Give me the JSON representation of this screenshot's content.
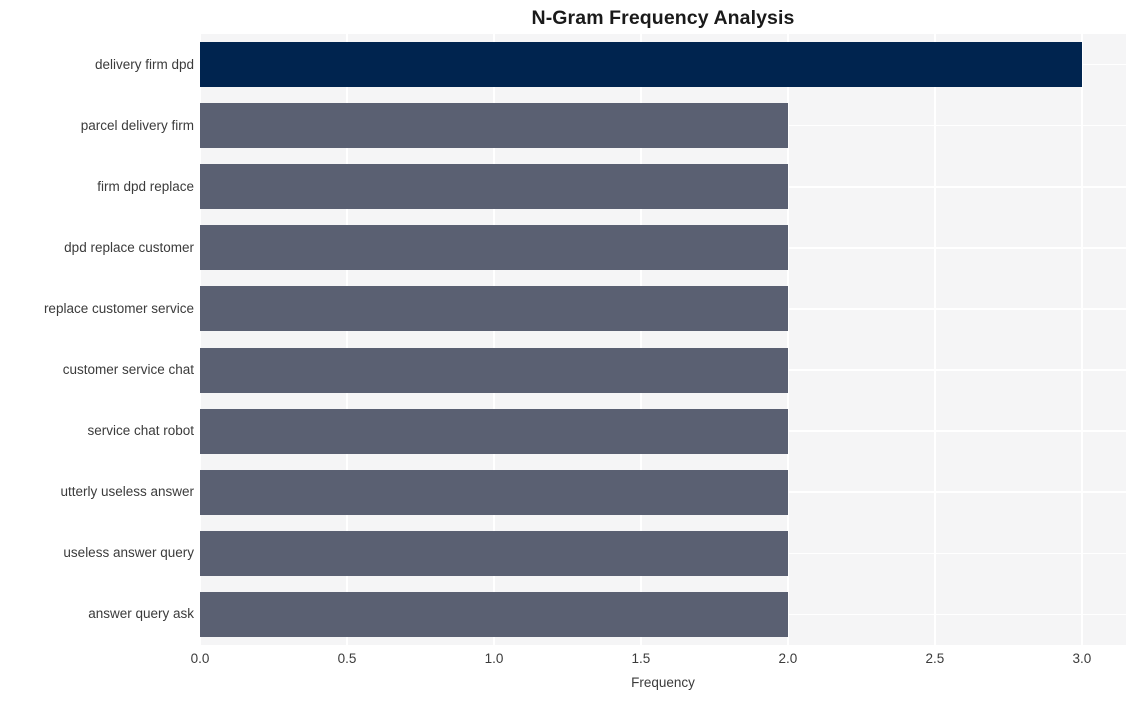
{
  "chart_data": {
    "type": "bar",
    "orientation": "horizontal",
    "title": "N-Gram Frequency Analysis",
    "xlabel": "Frequency",
    "ylabel": "",
    "xlim": [
      0.0,
      3.15
    ],
    "xticks": [
      "0.0",
      "0.5",
      "1.0",
      "1.5",
      "2.0",
      "2.5",
      "3.0"
    ],
    "xtick_values": [
      0.0,
      0.5,
      1.0,
      1.5,
      2.0,
      2.5,
      3.0
    ],
    "grid": true,
    "legend": "none",
    "categories": [
      "delivery firm dpd",
      "parcel delivery firm",
      "firm dpd replace",
      "dpd replace customer",
      "replace customer service",
      "customer service chat",
      "service chat robot",
      "utterly useless answer",
      "useless answer query",
      "answer query ask"
    ],
    "values": [
      3,
      2,
      2,
      2,
      2,
      2,
      2,
      2,
      2,
      2
    ],
    "bar_colors": [
      "#00244f",
      "#5a6072",
      "#5a6072",
      "#5a6072",
      "#5a6072",
      "#5a6072",
      "#5a6072",
      "#5a6072",
      "#5a6072",
      "#5a6072"
    ]
  },
  "style": {
    "plot_background": "#f5f5f6",
    "figure_background": "#ffffff",
    "gridline_color": "#ffffff",
    "text_color": "#3b3b3b",
    "title_color": "#1a1a1a",
    "highlight_color": "#00244f",
    "bar_color": "#5a6072"
  }
}
